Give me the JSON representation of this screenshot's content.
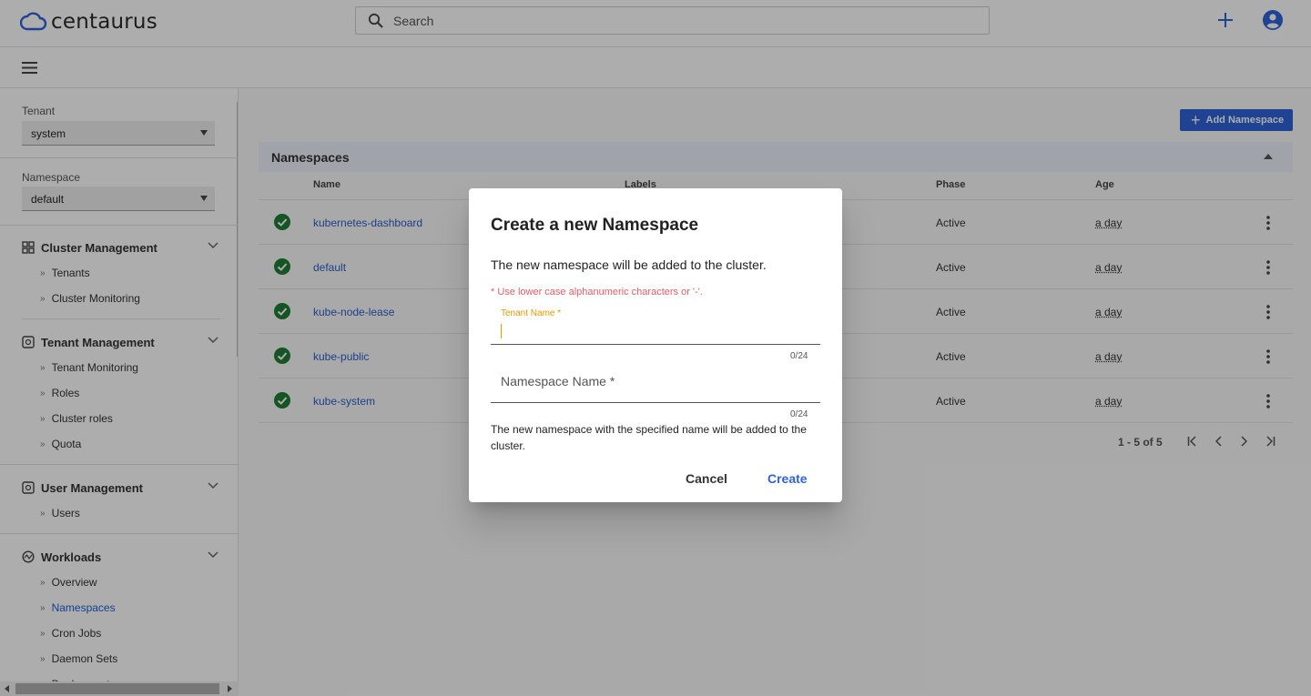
{
  "header": {
    "logo_text": "centaurus",
    "search_placeholder": "Search"
  },
  "sidebar": {
    "tenant_label": "Tenant",
    "tenant_value": "system",
    "namespace_label": "Namespace",
    "namespace_value": "default",
    "groups": [
      {
        "title": "Cluster Management",
        "items": [
          "Tenants",
          "Cluster Monitoring"
        ]
      },
      {
        "title": "Tenant Management",
        "items": [
          "Tenant Monitoring",
          "Roles",
          "Cluster roles",
          "Quota"
        ]
      },
      {
        "title": "User Management",
        "items": [
          "Users"
        ]
      },
      {
        "title": "Workloads",
        "items": [
          "Overview",
          "Namespaces",
          "Cron Jobs",
          "Daemon Sets",
          "Deployments"
        ],
        "active": "Namespaces"
      }
    ]
  },
  "main": {
    "add_button": "Add Namespace",
    "card_title": "Namespaces",
    "columns": [
      "Name",
      "Labels",
      "Phase",
      "Age"
    ],
    "rows": [
      {
        "name": "kubernetes-dashboard",
        "phase": "Active",
        "age": "a day"
      },
      {
        "name": "default",
        "phase": "Active",
        "age": "a day"
      },
      {
        "name": "kube-node-lease",
        "phase": "Active",
        "age": "a day"
      },
      {
        "name": "kube-public",
        "phase": "Active",
        "age": "a day"
      },
      {
        "name": "kube-system",
        "phase": "Active",
        "age": "a day"
      }
    ],
    "pagination": "1 - 5 of 5"
  },
  "dialog": {
    "title": "Create a new Namespace",
    "description": "The new namespace will be added to the cluster.",
    "warning": "* Use lower case alphanumeric characters or '-'.",
    "tenant_label": "Tenant Name *",
    "tenant_value": "",
    "tenant_hint": "0/24",
    "namespace_label": "Namespace Name *",
    "namespace_hint": "0/24",
    "note": "The new namespace with the specified name will be added to the cluster.",
    "cancel": "Cancel",
    "create": "Create"
  },
  "colors": {
    "brand_blue": "#2f63d8",
    "link_blue": "#2a5ec9",
    "status_green": "#1e7e34",
    "warning_red": "#e0606a",
    "focus_orange": "#e69a00"
  }
}
